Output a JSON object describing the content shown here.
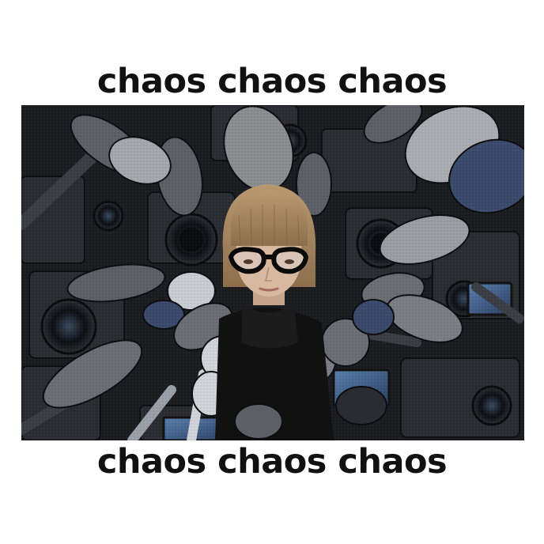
{
  "meme": {
    "top_text": "chaos chaos chaos",
    "bottom_text": "chaos chaos chaos"
  },
  "photo": {
    "subject": "person-with-bob-haircut-and-cat-eye-glasses",
    "surroundings": "press-microphones-and-video-cameras",
    "colors": {
      "background": "#1a1c20",
      "hair": "#a88a66",
      "skin": "#d9b8a0",
      "clothing": "#111111",
      "mic_gray": "#5c5f66",
      "mic_light": "#c9ccd2",
      "mic_blue": "#3b4a6b",
      "camera_body": "#2a2c31"
    }
  }
}
